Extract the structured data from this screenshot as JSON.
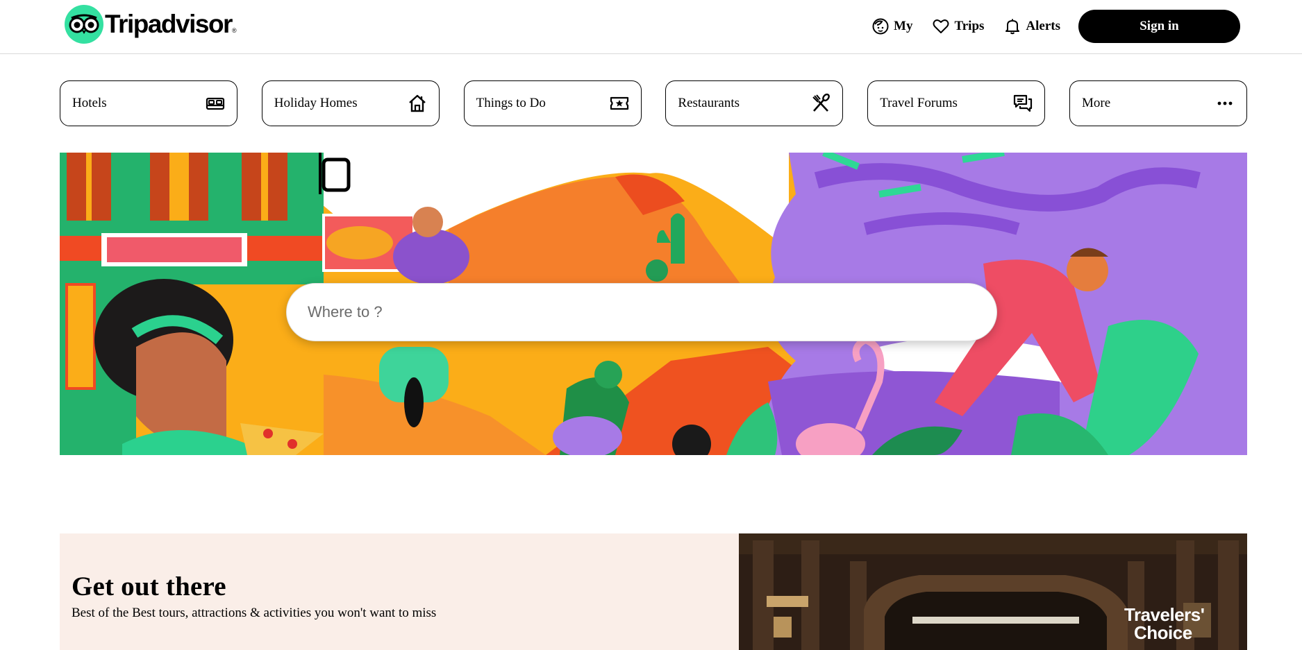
{
  "header": {
    "brand": "Tripadvisor",
    "nav": [
      {
        "label": "My",
        "icon": "face-profile-icon"
      },
      {
        "label": "Trips",
        "icon": "heart-icon"
      },
      {
        "label": "Alerts",
        "icon": "bell-icon"
      }
    ],
    "signin_label": "Sign in"
  },
  "categories": [
    {
      "label": "Hotels",
      "icon": "bed-icon"
    },
    {
      "label": "Holiday Homes",
      "icon": "house-icon"
    },
    {
      "label": "Things to Do",
      "icon": "ticket-icon"
    },
    {
      "label": "Restaurants",
      "icon": "fork-knife-icon"
    },
    {
      "label": "Travel Forums",
      "icon": "chat-bubbles-icon"
    },
    {
      "label": "More",
      "icon": "more-dots-icon"
    }
  ],
  "search": {
    "placeholder": "Where to ?"
  },
  "promo": {
    "title": "Get out there",
    "subtitle": "Best of the Best tours, attractions & activities you won't want to miss",
    "badge_line1": "Travelers'",
    "badge_line2": "Choice"
  },
  "colors": {
    "brand_green": "#34e0a1",
    "promo_bg": "#faeee8",
    "signin_bg": "#000000"
  }
}
